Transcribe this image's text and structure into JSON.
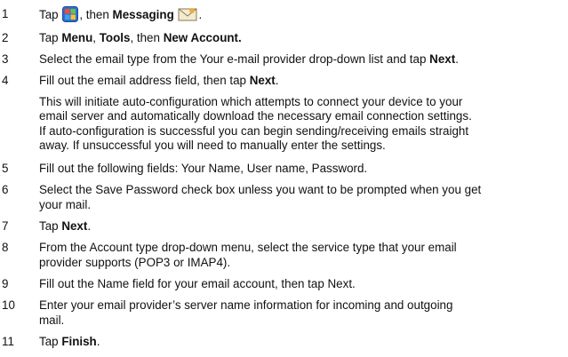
{
  "steps": [
    {
      "num": "1",
      "t1": "Tap ",
      "t2": ", then ",
      "b1": "Messaging",
      "t3": "."
    },
    {
      "num": "2",
      "t1": "Tap ",
      "b1": "Menu",
      "t2": ", ",
      "b2": "Tools",
      "t3": ", then ",
      "b3": "New Account."
    },
    {
      "num": "3",
      "t1": "Select the email type from the Your e-mail provider drop-down list and tap ",
      "b1": "Next",
      "t2": "."
    },
    {
      "num": "4",
      "t1": "Fill out the email address field, then tap ",
      "b1": "Next",
      "t2": "."
    },
    {
      "num": "5",
      "t1": "Fill out the following fields: Your Name, User name, Password."
    },
    {
      "num": "6",
      "l1": "Select the Save Password check box unless you want to be prompted when you get",
      "l2": "your mail."
    },
    {
      "num": "7",
      "t1": "Tap ",
      "b1": "Next",
      "t2": "."
    },
    {
      "num": "8",
      "l1": "From the Account type drop-down menu, select the service type that your email",
      "l2": "provider supports (POP3 or IMAP4)."
    },
    {
      "num": "9",
      "t1": "Fill out the Name field for your email account, then tap Next."
    },
    {
      "num": "10",
      "l1": "Enter your email provider’s server name information for incoming and outgoing",
      "l2": "mail."
    },
    {
      "num": "11",
      "t1": "Tap ",
      "b1": "Finish",
      "t2": "."
    }
  ],
  "note_lines": [
    "This will initiate auto-configuration which attempts to connect your device to your",
    "email server and automatically download the necessary email connection settings.",
    "If auto-configuration is successful you can begin sending/receiving emails straight",
    "away. If unsuccessful you will need to manually enter the settings."
  ],
  "icons": {
    "start": "windows-start-icon",
    "messaging": "messaging-envelope-icon"
  }
}
